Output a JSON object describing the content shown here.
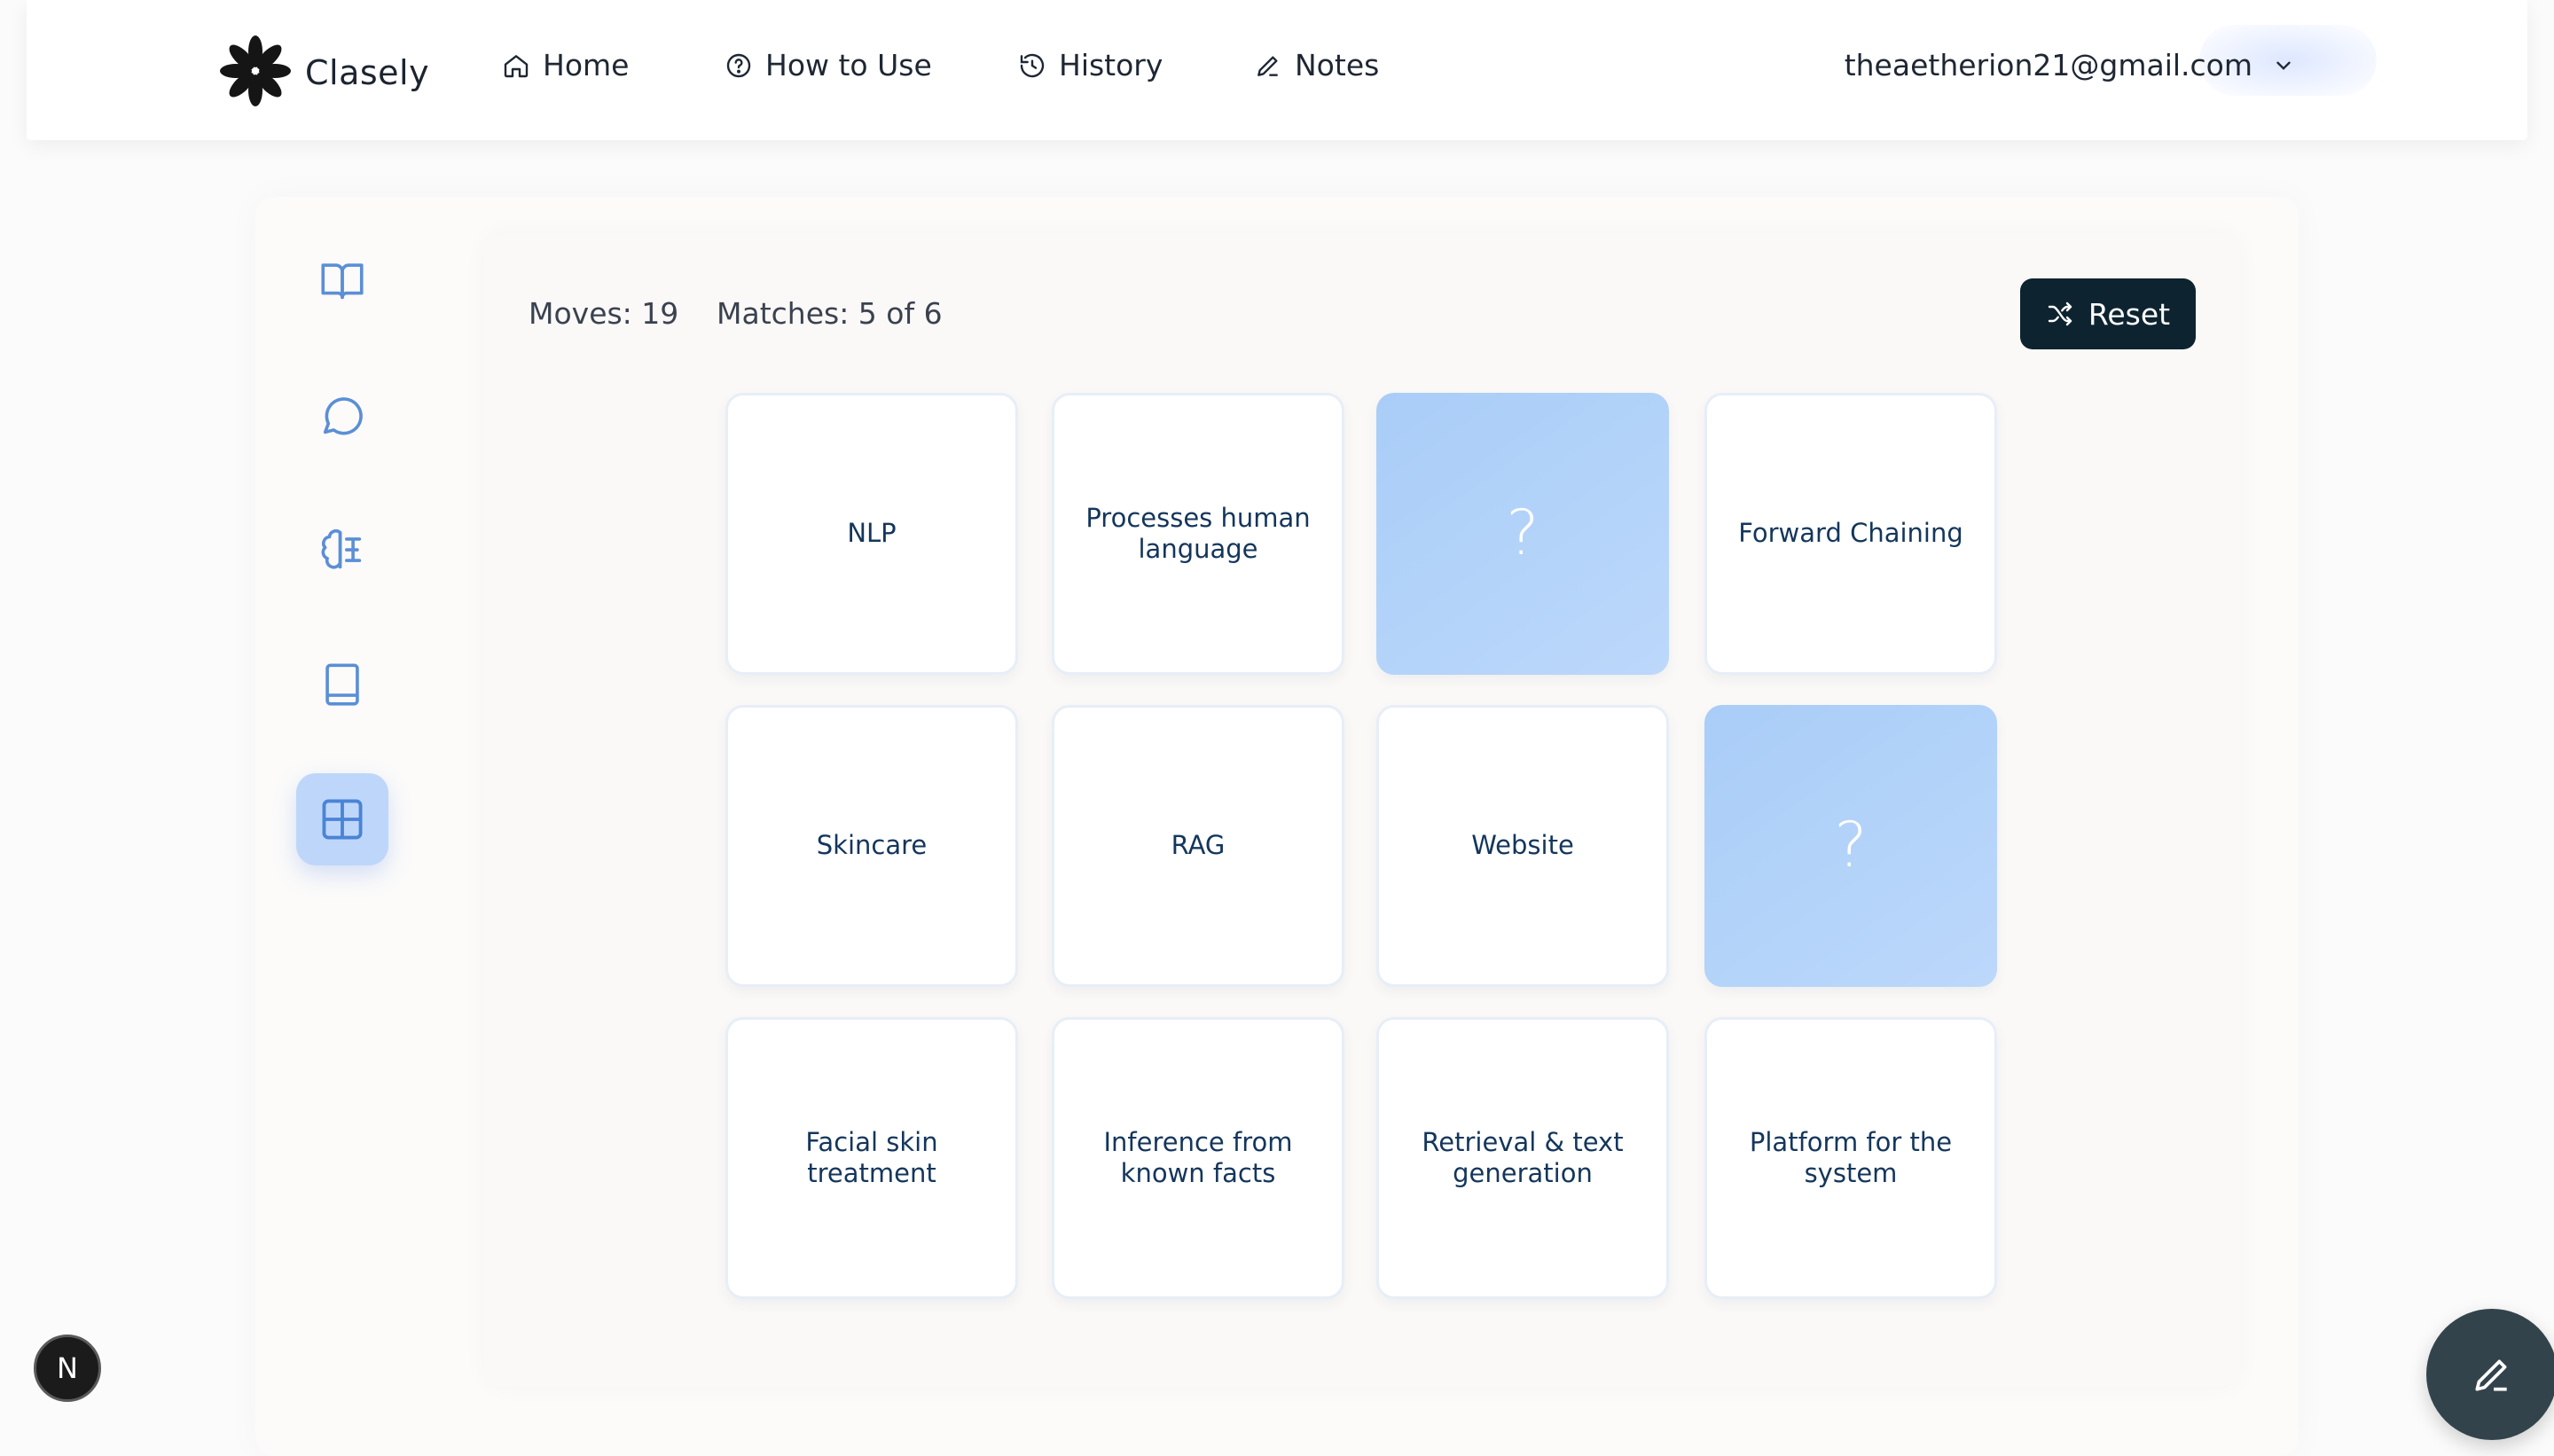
{
  "app": {
    "name": "Clasely"
  },
  "nav": [
    {
      "label": "Home",
      "icon": "home-icon"
    },
    {
      "label": "How to Use",
      "icon": "help-circle-icon"
    },
    {
      "label": "History",
      "icon": "history-icon"
    },
    {
      "label": "Notes",
      "icon": "pencil-icon"
    }
  ],
  "user": {
    "email": "theaetherion21@gmail.com"
  },
  "sidebar": [
    {
      "icon": "book-open-icon",
      "active": false
    },
    {
      "icon": "chat-bubble-icon",
      "active": false
    },
    {
      "icon": "brain-icon",
      "active": false
    },
    {
      "icon": "book-icon",
      "active": false
    },
    {
      "icon": "grid-icon",
      "active": true
    }
  ],
  "game": {
    "moves_label": "Moves: 19",
    "matches_label": "Matches: 5 of 6",
    "reset_label": "Reset",
    "cards": [
      [
        "NLP",
        "Processes human language",
        "?",
        "Forward Chaining"
      ],
      [
        "Skincare",
        "RAG",
        "Website",
        "?"
      ],
      [
        "Facial skin treatment",
        "Inference from known facts",
        "Retrieval & text generation",
        "Platform for the system"
      ]
    ]
  },
  "badge": {
    "letter": "N"
  },
  "colors": {
    "accent": "#0d2430",
    "card_hidden": "#b2d2f9",
    "sidebar_active": "#bfd6fb",
    "card_text": "#14365c"
  }
}
